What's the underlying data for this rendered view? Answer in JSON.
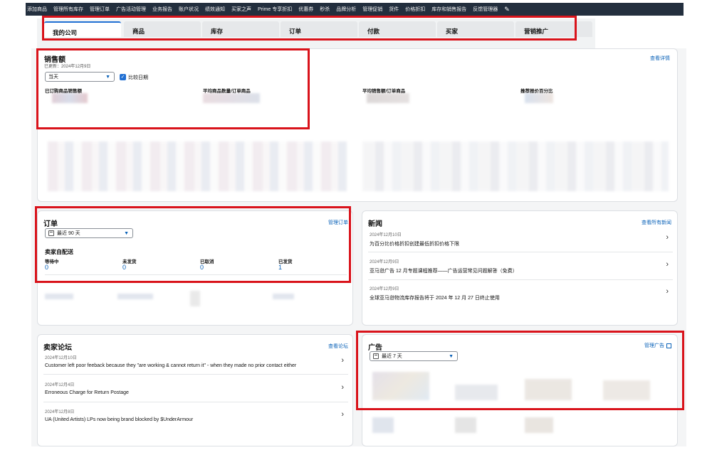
{
  "topnav": {
    "items": [
      "添加商品",
      "管理所有库存",
      "管理订单",
      "广告活动管理",
      "业务报告",
      "账户状况",
      "绩效通知",
      "买家之声",
      "Prime 专享折扣",
      "优惠券",
      "秒杀",
      "品牌分析",
      "管理促销",
      "货件",
      "价格折扣",
      "库存和销售报告",
      "反馈管理器"
    ]
  },
  "tabs": [
    "我的公司",
    "商品",
    "库存",
    "订单",
    "付款",
    "买家",
    "营销推广"
  ],
  "sales": {
    "title": "销售额",
    "updated": "已更新：2024年12月9日",
    "range_value": "当天",
    "compare_label": "比较日期",
    "details_link": "查看详情",
    "metrics": [
      "已订购商品销售额",
      "平均商品数量/订单商品",
      "平均销售额/订单商品",
      "推荐报价百分比"
    ]
  },
  "orders": {
    "title": "订单",
    "manage_link": "管理订单",
    "range_value": "最近 90 天",
    "section": "卖家自配送",
    "stats": [
      {
        "label": "等待中",
        "value": "0"
      },
      {
        "label": "未发货",
        "value": "0"
      },
      {
        "label": "已取消",
        "value": "0"
      },
      {
        "label": "已发货",
        "value": "1"
      }
    ]
  },
  "news": {
    "title": "新闻",
    "all_link": "查看所有新闻",
    "items": [
      {
        "date": "2024年12月10日",
        "text": "为百分比价格折扣创建最低折扣价格下限"
      },
      {
        "date": "2024年12月9日",
        "text": "亚马逊广告 12 月专题课程推荐——广告运营常见问题解答（免费）"
      },
      {
        "date": "2024年12月9日",
        "text": "全球亚马逊物流库存报告将于 2024 年 12 月 27 日终止使用"
      }
    ]
  },
  "forum": {
    "title": "卖家论坛",
    "view_link": "查看论坛",
    "items": [
      {
        "date": "2024年12月10日",
        "text": "Customer left poor feeback because they \"are working & cannot return it\" - when they made no prior contact either"
      },
      {
        "date": "2024年12月4日",
        "text": "Erroneous Charge for Return Postage"
      },
      {
        "date": "2024年12月8日",
        "text": "UA (United Artists) LPs now being brand blocked by $UnderArmour"
      }
    ]
  },
  "ads": {
    "title": "广告",
    "manage_link": "管理广告",
    "range_value": "最近 7 天"
  },
  "colors": {
    "highlight": "#d9131b",
    "link": "#0a62b8",
    "nav_bg": "#232f3e"
  }
}
